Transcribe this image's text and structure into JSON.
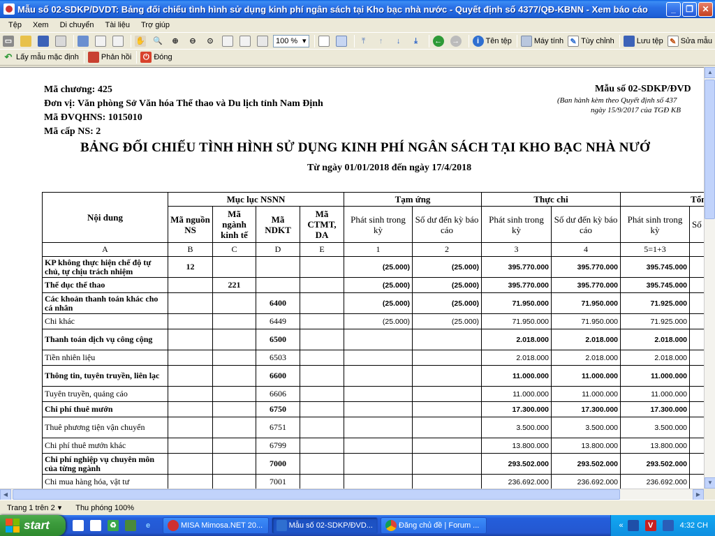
{
  "window": {
    "title": "Mẫu số 02-SDKP/DVDT: Bảng đối chiếu tình hình sử dụng kinh phí ngân sách tại Kho bạc nhà nước - Quyết định số 4377/QĐ-KBNN - Xem báo cáo"
  },
  "menu": [
    "Tệp",
    "Xem",
    "Di chuyển",
    "Tài liệu",
    "Trợ giúp"
  ],
  "toolbar": {
    "zoom_value": "100 %",
    "ten_tep": "Tên tệp",
    "may_tinh": "Máy tính",
    "tuy_chinh": "Tùy chỉnh",
    "luu_tep": "Lưu tệp",
    "sua_mau": "Sửa mẫu",
    "lay_mau": "Lấy mẫu mặc định",
    "phan_hoi": "Phản hồi",
    "dong": "Đóng"
  },
  "report": {
    "ma_chuong": "Mã chương: 425",
    "don_vi": "Đơn vị: Văn phòng Sở Văn hóa Thể thao và Du lịch tỉnh Nam Định",
    "ma_dvqhns": "Mã ĐVQHNS: 1015010",
    "ma_cap": "Mã cấp NS: 2",
    "form_code": "Mẫu số 02-SDKP/ĐVD",
    "issued_line1": "(Ban hành kèm theo Quyết định số 437",
    "issued_line2": "ngày 15/9/2017 của TGĐ KB",
    "title": "BẢNG ĐỐI CHIẾU TÌNH HÌNH SỬ DỤNG KINH PHÍ NGÂN SÁCH TẠI KHO BẠC NHÀ NƯỚ",
    "period": "Từ ngày 01/01/2018 đến ngày 17/4/2018",
    "headers": {
      "noi_dung": "Nội dung",
      "muc_luc": "Mục lục NSNN",
      "tam_ung": "Tạm ứng",
      "thuc_chi": "Thực chi",
      "tong": "Tổng",
      "ma_nguon": "Mã nguồn NS",
      "ma_nganh": "Mã ngành kinh tế",
      "ma_ndkt": "Mã NDKT",
      "ma_ctmt": "Mã CTMT, DA",
      "phat_sinh": "Phát sinh trong kỳ",
      "so_du": "Số dư đến kỳ báo cáo",
      "last_col": "Số"
    },
    "letters": [
      "A",
      "B",
      "C",
      "D",
      "E",
      "1",
      "2",
      "3",
      "4",
      "5=1+3",
      ""
    ],
    "rows": [
      {
        "noi_dung": "KP không thực hiện chế độ tự chủ, tự chịu trách nhiệm",
        "b": "12",
        "c": "",
        "d": "",
        "e": "",
        "v1": "(25.000)",
        "v2": "(25.000)",
        "v3": "395.770.000",
        "v4": "395.770.000",
        "v5": "395.745.000",
        "bold": true
      },
      {
        "noi_dung": "Thể dục thể thao",
        "b": "",
        "c": "221",
        "d": "",
        "e": "",
        "v1": "(25.000)",
        "v2": "(25.000)",
        "v3": "395.770.000",
        "v4": "395.770.000",
        "v5": "395.745.000",
        "bold": true
      },
      {
        "noi_dung": "Các khoản thanh toán khác cho cá nhân",
        "b": "",
        "c": "",
        "d": "6400",
        "e": "",
        "v1": "(25.000)",
        "v2": "(25.000)",
        "v3": "71.950.000",
        "v4": "71.950.000",
        "v5": "71.925.000",
        "bold": true
      },
      {
        "noi_dung": "Chi khác",
        "b": "",
        "c": "",
        "d": "6449",
        "e": "",
        "v1": "(25.000)",
        "v2": "(25.000)",
        "v3": "71.950.000",
        "v4": "71.950.000",
        "v5": "71.925.000",
        "bold": false
      },
      {
        "noi_dung": "Thanh toán dịch vụ công cộng",
        "b": "",
        "c": "",
        "d": "6500",
        "e": "",
        "v1": "",
        "v2": "",
        "v3": "2.018.000",
        "v4": "2.018.000",
        "v5": "2.018.000",
        "bold": true
      },
      {
        "noi_dung": "Tiền nhiên liệu",
        "b": "",
        "c": "",
        "d": "6503",
        "e": "",
        "v1": "",
        "v2": "",
        "v3": "2.018.000",
        "v4": "2.018.000",
        "v5": "2.018.000",
        "bold": false
      },
      {
        "noi_dung": "Thông tin, tuyên truyền, liên lạc",
        "b": "",
        "c": "",
        "d": "6600",
        "e": "",
        "v1": "",
        "v2": "",
        "v3": "11.000.000",
        "v4": "11.000.000",
        "v5": "11.000.000",
        "bold": true
      },
      {
        "noi_dung": "Tuyên truyền, quảng cáo",
        "b": "",
        "c": "",
        "d": "6606",
        "e": "",
        "v1": "",
        "v2": "",
        "v3": "11.000.000",
        "v4": "11.000.000",
        "v5": "11.000.000",
        "bold": false
      },
      {
        "noi_dung": "Chi phí thuê mướn",
        "b": "",
        "c": "",
        "d": "6750",
        "e": "",
        "v1": "",
        "v2": "",
        "v3": "17.300.000",
        "v4": "17.300.000",
        "v5": "17.300.000",
        "bold": true
      },
      {
        "noi_dung": "Thuê phương tiện vận chuyển",
        "b": "",
        "c": "",
        "d": "6751",
        "e": "",
        "v1": "",
        "v2": "",
        "v3": "3.500.000",
        "v4": "3.500.000",
        "v5": "3.500.000",
        "bold": false
      },
      {
        "noi_dung": "Chi phí thuê mướn khác",
        "b": "",
        "c": "",
        "d": "6799",
        "e": "",
        "v1": "",
        "v2": "",
        "v3": "13.800.000",
        "v4": "13.800.000",
        "v5": "13.800.000",
        "bold": false
      },
      {
        "noi_dung": "Chi phí nghiệp vụ chuyên môn của từng ngành",
        "b": "",
        "c": "",
        "d": "7000",
        "e": "",
        "v1": "",
        "v2": "",
        "v3": "293.502.000",
        "v4": "293.502.000",
        "v5": "293.502.000",
        "bold": true
      },
      {
        "noi_dung": "Chi mua hàng hóa, vật tư",
        "b": "",
        "c": "",
        "d": "7001",
        "e": "",
        "v1": "",
        "v2": "",
        "v3": "236.692.000",
        "v4": "236.692.000",
        "v5": "236.692.000",
        "bold": false
      }
    ]
  },
  "statusbar": {
    "page": "Trang 1 trên 2",
    "zoom": "Thu phóng 100%"
  },
  "taskbar": {
    "start": "start",
    "tasks": [
      "MISA Mimosa.NET 20...",
      "Mẫu số 02-SDKP/ĐVD...",
      "Đăng chủ đề | Forum ..."
    ],
    "lang": "V",
    "clock": "4:32 CH"
  }
}
